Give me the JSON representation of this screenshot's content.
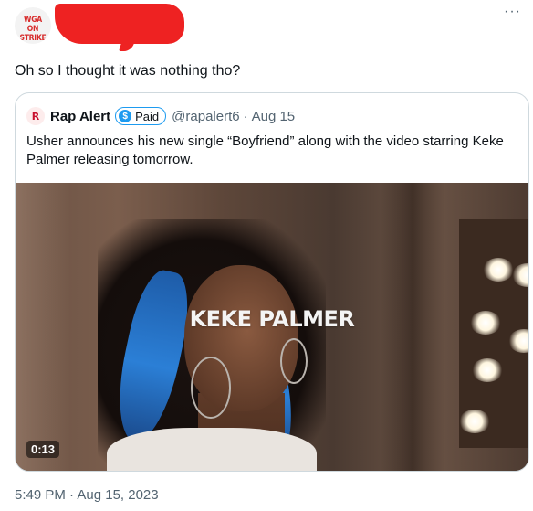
{
  "author": {
    "avatar_text": "WGA ON STRIKE"
  },
  "more_icon": "more-horizontal-icon",
  "tweet": {
    "text": "Oh so I thought it was nothing tho?",
    "timestamp": "5:49 PM · Aug 15, 2023"
  },
  "quote": {
    "name": "Rap Alert",
    "badge_label": "Paid",
    "badge_icon": "dollar-sign-icon",
    "handle": "@rapalert6",
    "separator": "·",
    "date": "Aug 15",
    "text": "Usher announces his new single “Boyfriend” along with the video starring Keke Palmer releasing tomorrow.",
    "media": {
      "overlay_title": "KEKE PALMER",
      "duration": "0:13"
    }
  },
  "colors": {
    "redaction": "#ee2222",
    "accent": "#1d9bf0",
    "muted_text": "#536471",
    "border": "#cfd9de"
  }
}
